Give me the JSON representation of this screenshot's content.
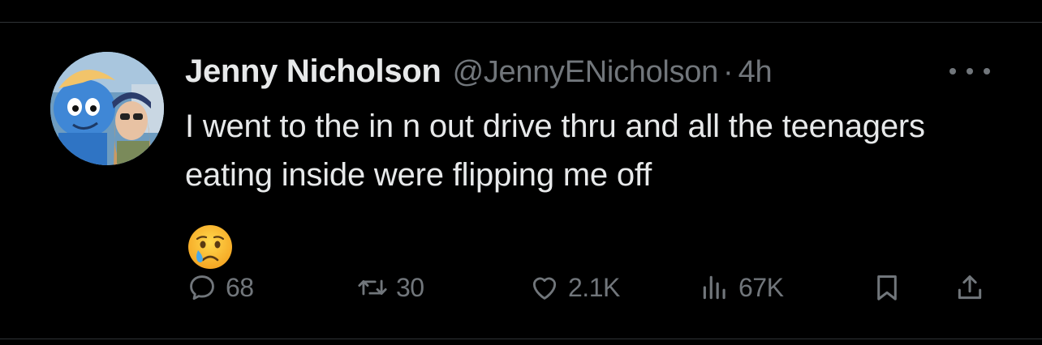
{
  "author": {
    "name": "Jenny Nicholson",
    "handle": "@JennyENicholson",
    "separator": "·",
    "time": "4h"
  },
  "tweet": {
    "text": "I went to the in n out drive thru and all the teenagers eating inside were flipping me off",
    "emoji": "crying-face"
  },
  "actions": {
    "replies": "68",
    "retweets": "30",
    "likes": "2.1K",
    "views": "67K"
  },
  "colors": {
    "background": "#000000",
    "text": "#e7e9ea",
    "muted": "#71767b",
    "divider": "#2f3336"
  },
  "icons": [
    "more-icon",
    "reply-icon",
    "retweet-icon",
    "like-icon",
    "views-icon",
    "bookmark-icon",
    "share-icon"
  ]
}
